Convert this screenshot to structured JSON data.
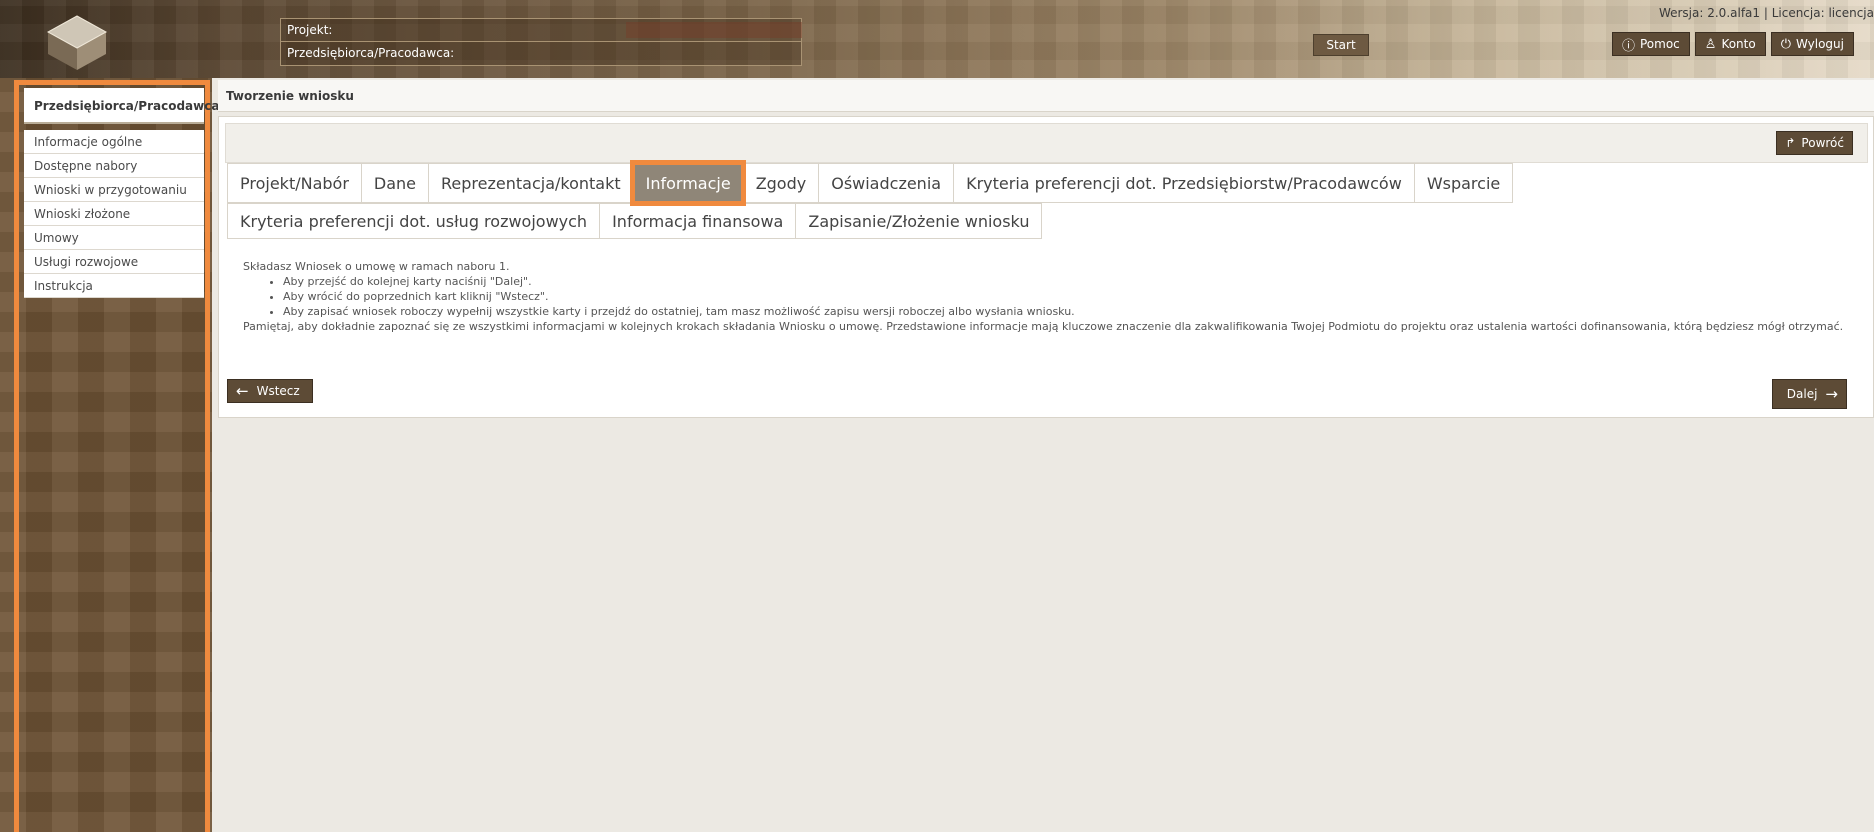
{
  "header": {
    "project_label": "Projekt:",
    "employer_label": "Przedsiębiorca/Pracodawca:",
    "start_label": "Start",
    "version_text": "Wersja: 2.0.alfa1 | Licencja: licencja",
    "help_label": "Pomoc",
    "account_label": "Konto",
    "logout_label": "Wyloguj"
  },
  "sidebar": {
    "title": "Przedsiębiorca/Pracodawca",
    "items": [
      {
        "label": "Informacje ogólne"
      },
      {
        "label": "Dostępne nabory"
      },
      {
        "label": "Wnioski w przygotowaniu"
      },
      {
        "label": "Wnioski złożone"
      },
      {
        "label": "Umowy"
      },
      {
        "label": "Usługi rozwojowe"
      },
      {
        "label": "Instrukcja"
      }
    ]
  },
  "page": {
    "title": "Tworzenie wniosku",
    "back_label": "Powróć",
    "tabs_row1": [
      "Projekt/Nabór",
      "Dane",
      "Reprezentacja/kontakt",
      "Informacje",
      "Zgody",
      "Oświadczenia",
      "Kryteria preferencji dot. Przedsiębiorstw/Pracodawców",
      "Wsparcie"
    ],
    "tabs_row2": [
      "Kryteria preferencji dot. usług rozwojowych",
      "Informacja finansowa",
      "Zapisanie/Złożenie wniosku"
    ],
    "active_tab": "Informacje",
    "info_intro": "Składasz Wniosek o umowę w ramach naboru 1.",
    "info_bullets": [
      "Aby przejść do kolejnej karty naciśnij \"Dalej\".",
      "Aby wrócić do poprzednich kart kliknij \"Wstecz\".",
      "Aby zapisać wniosek roboczy wypełnij wszystkie karty i przejdź do ostatniej, tam masz możliwość zapisu wersji roboczej albo wysłania wniosku."
    ],
    "info_note": "Pamiętaj, aby dokładnie zapoznać się ze wszystkimi informacjami w kolejnych krokach składania Wniosku o umowę. Przedstawione informacje mają kluczowe znaczenie dla zakwalifikowania Twojej Podmiotu do projektu oraz ustalenia wartości dofinansowania, którą będziesz mógł otrzymać.",
    "prev_label": "Wstecz",
    "next_label": "Dalej"
  },
  "icons": {
    "help": "info-icon",
    "account": "user-icon",
    "logout": "power-icon",
    "back": "return-arrow-icon",
    "prev": "arrow-left-icon",
    "next": "arrow-right-icon"
  },
  "colors": {
    "accent": "#f08a3e",
    "button": "#5d4b36",
    "active_tab": "#8f8678"
  }
}
